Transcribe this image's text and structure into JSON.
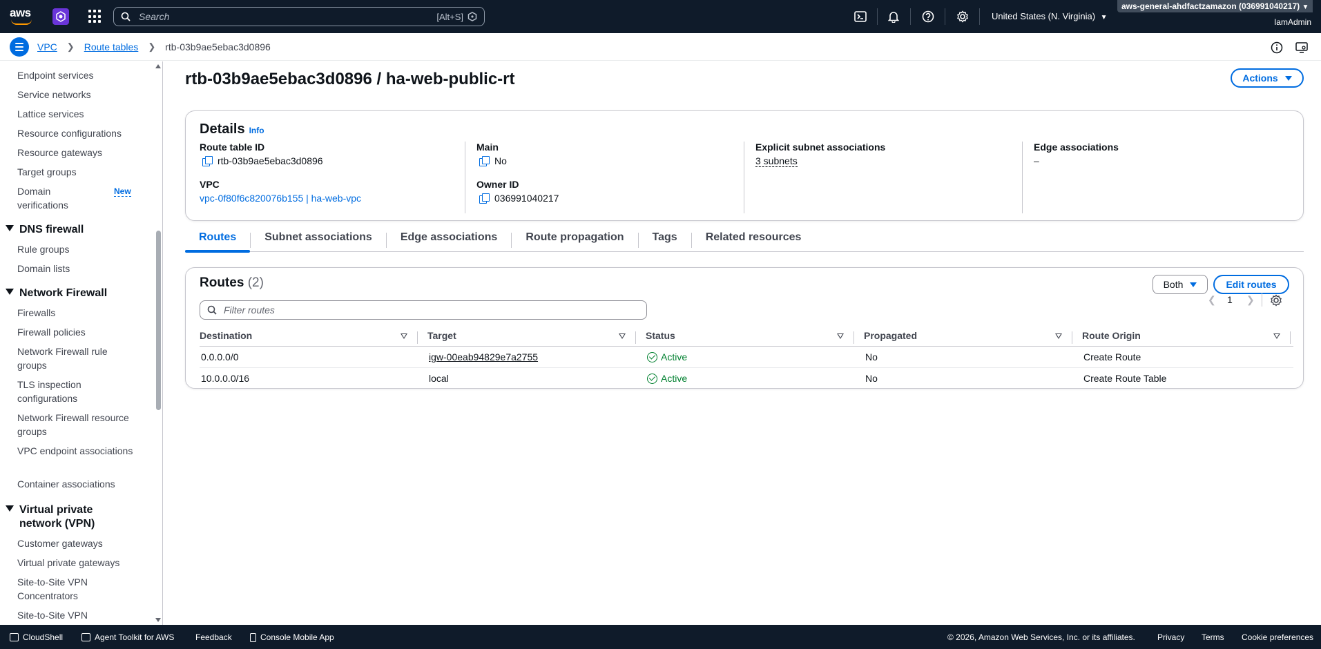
{
  "topnav": {
    "logo_text": "aws",
    "search_placeholder": "Search",
    "search_shortcut": "[Alt+S]",
    "region": "United States (N. Virginia)",
    "account": "aws-general-ahdfactzamazon (036991040217)",
    "user": "IamAdmin"
  },
  "breadcrumb": {
    "items": [
      "VPC",
      "Route tables"
    ],
    "current": "rtb-03b9ae5ebac3d0896"
  },
  "sidebar": {
    "top_items": [
      "Endpoint services",
      "Service networks",
      "Lattice services",
      "Resource configurations",
      "Resource gateways",
      "Target groups"
    ],
    "domain_verifications": "Domain verifications",
    "new_badge": "New",
    "sections": [
      {
        "title": "DNS firewall",
        "items": [
          "Rule groups",
          "Domain lists"
        ]
      },
      {
        "title": "Network Firewall",
        "items": [
          "Firewalls",
          "Firewall policies",
          "Network Firewall rule groups",
          "TLS inspection configurations",
          "Network Firewall resource groups",
          "VPC endpoint associations",
          "Container associations"
        ]
      },
      {
        "title": "Virtual private network (VPN)",
        "items": [
          "Customer gateways",
          "Virtual private gateways",
          "Site-to-Site VPN Concentrators",
          "Site-to-Site VPN"
        ]
      }
    ]
  },
  "page": {
    "title": "rtb-03b9ae5ebac3d0896 / ha-web-public-rt",
    "actions_label": "Actions"
  },
  "details": {
    "title": "Details",
    "info": "Info",
    "route_table_id_label": "Route table ID",
    "route_table_id": "rtb-03b9ae5ebac3d0896",
    "vpc_label": "VPC",
    "vpc": "vpc-0f80f6c820076b155 | ha-web-vpc",
    "main_label": "Main",
    "main": "No",
    "owner_id_label": "Owner ID",
    "owner_id": "036991040217",
    "explicit_label": "Explicit subnet associations",
    "explicit": "3 subnets",
    "edge_label": "Edge associations",
    "edge": "–"
  },
  "tabs": [
    "Routes",
    "Subnet associations",
    "Edge associations",
    "Route propagation",
    "Tags",
    "Related resources"
  ],
  "routes": {
    "title": "Routes",
    "count": "(2)",
    "filter_value": "Both",
    "edit_label": "Edit routes",
    "filter_placeholder": "Filter routes",
    "page": "1",
    "columns": [
      "Destination",
      "Target",
      "Status",
      "Propagated",
      "Route Origin"
    ],
    "rows": [
      {
        "destination": "0.0.0.0/0",
        "target": "igw-00eab94829e7a2755",
        "status": "Active",
        "propagated": "No",
        "origin": "Create Route"
      },
      {
        "destination": "10.0.0.0/16",
        "target": "local",
        "status": "Active",
        "propagated": "No",
        "origin": "Create Route Table"
      }
    ]
  },
  "footer": {
    "cloudshell": "CloudShell",
    "agent_toolkit": "Agent Toolkit for AWS",
    "feedback": "Feedback",
    "mobile_app": "Console Mobile App",
    "copyright": "© 2026, Amazon Web Services, Inc. or its affiliates.",
    "privacy": "Privacy",
    "terms": "Terms",
    "cookies": "Cookie preferences"
  },
  "colors": {
    "nav_bg": "#0f1b2a",
    "link": "#006ce0",
    "success": "#00802f"
  }
}
